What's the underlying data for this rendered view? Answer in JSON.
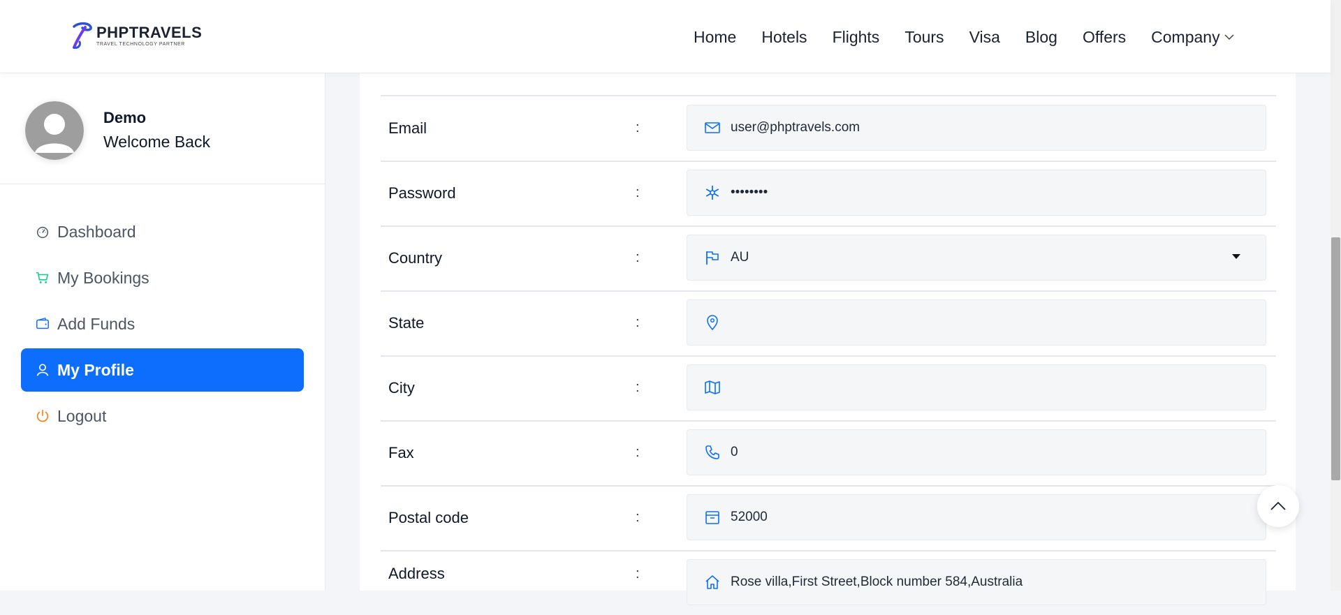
{
  "brand": {
    "name": "PHPTRAVELS",
    "tagline": "TRAVEL TECHNOLOGY PARTNER",
    "color": "#2f4fd6"
  },
  "nav": {
    "items": [
      "Home",
      "Hotels",
      "Flights",
      "Tours",
      "Visa",
      "Blog",
      "Offers"
    ],
    "company": "Company"
  },
  "user": {
    "name": "Demo",
    "welcome": "Welcome Back"
  },
  "sidebar": {
    "items": [
      {
        "label": "Dashboard",
        "icon": "dashboard-gauge-icon",
        "active": false
      },
      {
        "label": "My Bookings",
        "icon": "cart-icon",
        "active": false
      },
      {
        "label": "Add Funds",
        "icon": "wallet-icon",
        "active": false
      },
      {
        "label": "My Profile",
        "icon": "user-icon",
        "active": true
      },
      {
        "label": "Logout",
        "icon": "power-icon",
        "active": false
      }
    ]
  },
  "form": {
    "colon": ":",
    "fields": [
      {
        "label": "Email",
        "value": "user@phptravels.com",
        "icon": "envelope-icon"
      },
      {
        "label": "Password",
        "value": "••••••••",
        "icon": "asterisk-icon"
      },
      {
        "label": "Country",
        "value": "AU",
        "icon": "flag-icon"
      },
      {
        "label": "State",
        "value": "",
        "icon": "pin-icon"
      },
      {
        "label": "City",
        "value": "",
        "icon": "map-icon"
      },
      {
        "label": "Fax",
        "value": "0",
        "icon": "phone-icon"
      },
      {
        "label": "Postal code",
        "value": "52000",
        "icon": "box-icon"
      },
      {
        "label": "Address",
        "value": "Rose villa,First Street,Block number 584,Australia",
        "icon": "home-icon"
      }
    ]
  },
  "colors": {
    "accent": "#0d6efd",
    "icon_blue": "#0d6efd",
    "cart_green": "#20c997",
    "logout_orange": "#fd7e14"
  }
}
